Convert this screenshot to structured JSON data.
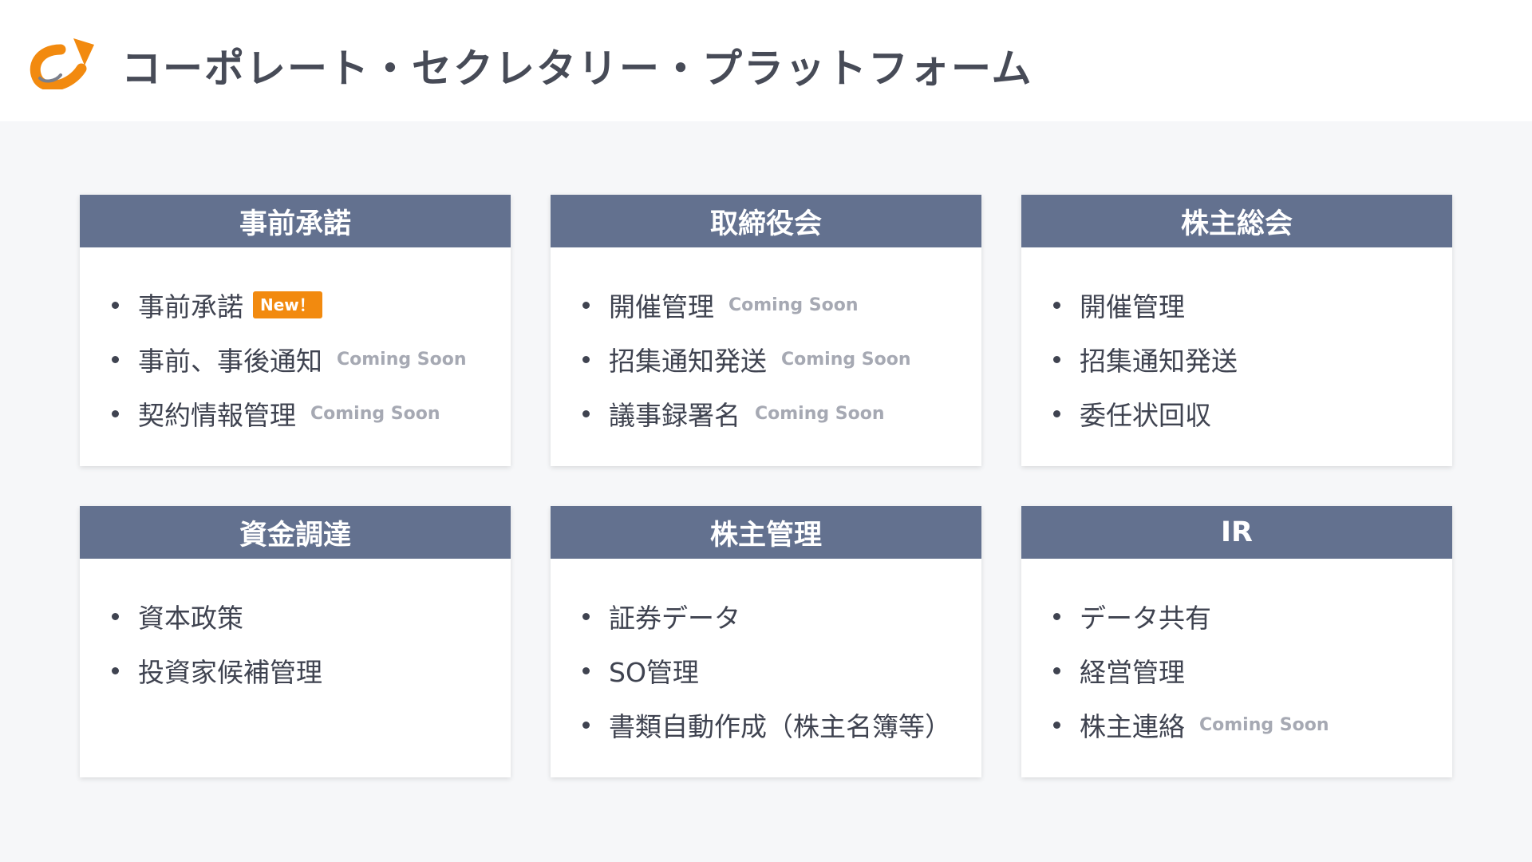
{
  "header": {
    "title": "コーポレート・セクレタリー・プラットフォーム",
    "logo_icon": "orange-arrow-logo-icon"
  },
  "colors": {
    "card_header": "#63718f",
    "badge": "#f28a0f",
    "coming_soon": "#a6a9b3",
    "logo": "#f28a0f"
  },
  "cards": [
    {
      "title": "事前承諾",
      "items": [
        {
          "label": "事前承諾",
          "badge": "New！",
          "status": ""
        },
        {
          "label": "事前、事後通知",
          "badge": "",
          "status": "Coming Soon"
        },
        {
          "label": "契約情報管理",
          "badge": "",
          "status": "Coming Soon"
        }
      ]
    },
    {
      "title": "取締役会",
      "items": [
        {
          "label": "開催管理",
          "badge": "",
          "status": "Coming Soon"
        },
        {
          "label": "招集通知発送",
          "badge": "",
          "status": "Coming Soon"
        },
        {
          "label": "議事録署名",
          "badge": "",
          "status": "Coming Soon"
        }
      ]
    },
    {
      "title": "株主総会",
      "items": [
        {
          "label": "開催管理",
          "badge": "",
          "status": ""
        },
        {
          "label": "招集通知発送",
          "badge": "",
          "status": ""
        },
        {
          "label": "委任状回収",
          "badge": "",
          "status": ""
        }
      ]
    },
    {
      "title": "資金調達",
      "items": [
        {
          "label": "資本政策",
          "badge": "",
          "status": ""
        },
        {
          "label": "投資家候補管理",
          "badge": "",
          "status": ""
        }
      ]
    },
    {
      "title": "株主管理",
      "items": [
        {
          "label": "証券データ",
          "badge": "",
          "status": ""
        },
        {
          "label": "SO管理",
          "badge": "",
          "status": ""
        },
        {
          "label": "書類自動作成（株主名簿等）",
          "badge": "",
          "status": ""
        }
      ]
    },
    {
      "title": "IR",
      "items": [
        {
          "label": "データ共有",
          "badge": "",
          "status": ""
        },
        {
          "label": "経営管理",
          "badge": "",
          "status": ""
        },
        {
          "label": "株主連絡",
          "badge": "",
          "status": "Coming Soon"
        }
      ]
    }
  ]
}
